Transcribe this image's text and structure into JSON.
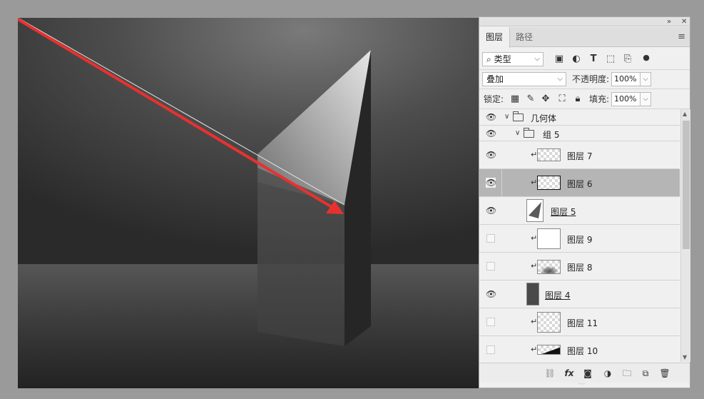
{
  "panel": {
    "collapse_icon": "double-chevron-right-icon",
    "close_icon": "close-icon",
    "tabs": [
      {
        "label": "图层",
        "active": true
      },
      {
        "label": "路径",
        "active": false
      }
    ],
    "menu_icon": "panel-menu-icon",
    "filter": {
      "kind_label": "类型",
      "icons": [
        "image-filter-icon",
        "adjustment-filter-icon",
        "type-filter-icon",
        "shape-filter-icon",
        "smart-object-filter-icon",
        "filter-toggle-icon"
      ]
    },
    "blend": {
      "mode": "叠加",
      "opacity_label": "不透明度:",
      "opacity_value": "100%"
    },
    "lock": {
      "label": "锁定:",
      "icons": [
        "lock-transparent-icon",
        "lock-image-icon",
        "lock-position-icon",
        "lock-artboard-icon",
        "lock-all-icon"
      ],
      "fill_label": "填充:",
      "fill_value": "100%"
    },
    "layers": [
      {
        "name": "几何体",
        "type": "group",
        "visible": true,
        "expanded": true,
        "indent": 0
      },
      {
        "name": "组 5",
        "type": "group",
        "visible": true,
        "expanded": true,
        "indent": 1
      },
      {
        "name": "图层 7",
        "type": "layer",
        "visible": true,
        "clipped": true,
        "thumb": "checker"
      },
      {
        "name": "图层 6",
        "type": "layer",
        "visible": true,
        "clipped": true,
        "thumb": "checker",
        "selected": true
      },
      {
        "name": "图层 5",
        "type": "layer",
        "visible": true,
        "clipped": false,
        "thumb": "shape",
        "underlined": true
      },
      {
        "name": "图层 9",
        "type": "layer",
        "visible": false,
        "clipped": true,
        "thumb": "white"
      },
      {
        "name": "图层 8",
        "type": "layer",
        "visible": false,
        "clipped": true,
        "thumb": "soft"
      },
      {
        "name": "图层 4",
        "type": "layer",
        "visible": true,
        "clipped": false,
        "thumb": "dark",
        "underlined": true
      },
      {
        "name": "图层 11",
        "type": "layer",
        "visible": false,
        "clipped": true,
        "thumb": "checker"
      },
      {
        "name": "图层 10",
        "type": "layer",
        "visible": false,
        "clipped": true,
        "thumb": "gradient"
      }
    ],
    "footer_icons": [
      "link-layers-icon",
      "fx-icon",
      "add-mask-icon",
      "adjustment-layer-icon",
      "new-group-icon",
      "new-layer-icon",
      "trash-icon"
    ],
    "footer_fx_text": "fx"
  },
  "colors": {
    "arrow": "#e8312f",
    "selected_row": "#b5b5b5",
    "panel_bg": "#f0f0f0"
  }
}
